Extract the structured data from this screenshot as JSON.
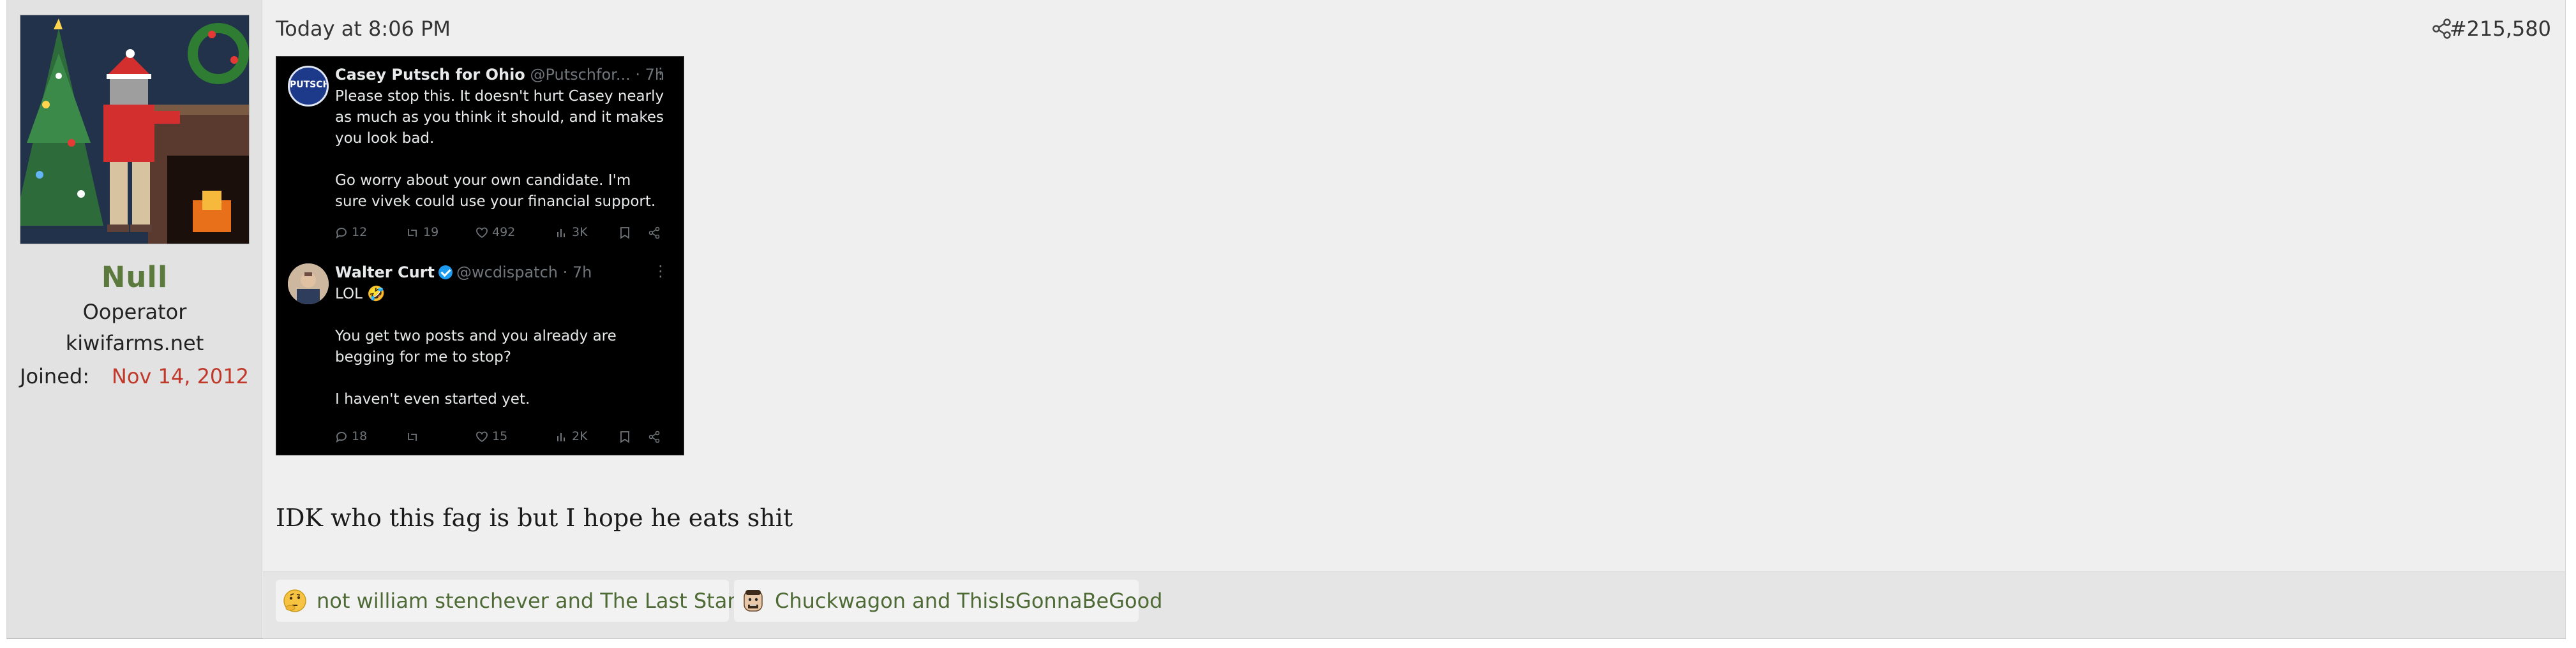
{
  "user": {
    "name": "Null",
    "title": "Ooperator",
    "site": "kiwifarms.net",
    "joined_label": "Joined:",
    "joined_value": "Nov 14, 2012"
  },
  "post": {
    "timestamp": "Today at 8:06 PM",
    "number": "#215,580",
    "text": "IDK who this fag is but I hope he eats shit"
  },
  "tweets": [
    {
      "avatar_text": "PUTSCH",
      "name": "Casey Putsch for Ohio",
      "handle": "@Putschfor... · 7h",
      "more": "⋮",
      "text": "Please stop this. It doesn't hurt Casey nearly as much as you think it should, and it makes you look bad.\n\nGo worry about your own candidate. I'm sure vivek could use your financial support.",
      "replies": "12",
      "reposts": "19",
      "likes": "492",
      "views": "3K"
    },
    {
      "avatar_text": "",
      "name": "Walter Curt",
      "handle": "@wcdispatch · 7h",
      "more": "⋮",
      "text": "LOL 🤣\n\nYou get two posts and you already are begging for me to stop?\n\nI haven't even started yet.",
      "replies": "18",
      "reposts": "",
      "likes": "15",
      "views": "2K"
    }
  ],
  "reactions": [
    {
      "icon": "thinking-emoji-icon",
      "text": "not william stenchever and The Last Stand"
    },
    {
      "icon": "reaction-face-icon",
      "text": "Chuckwagon and ThisIsGonnaBeGood"
    }
  ],
  "colors": {
    "username": "#5c7a3e",
    "joined_date": "#c0392b",
    "reaction_text": "#4e6b36",
    "post_bg": "#efefef",
    "user_col_bg": "#e2e2e2"
  }
}
